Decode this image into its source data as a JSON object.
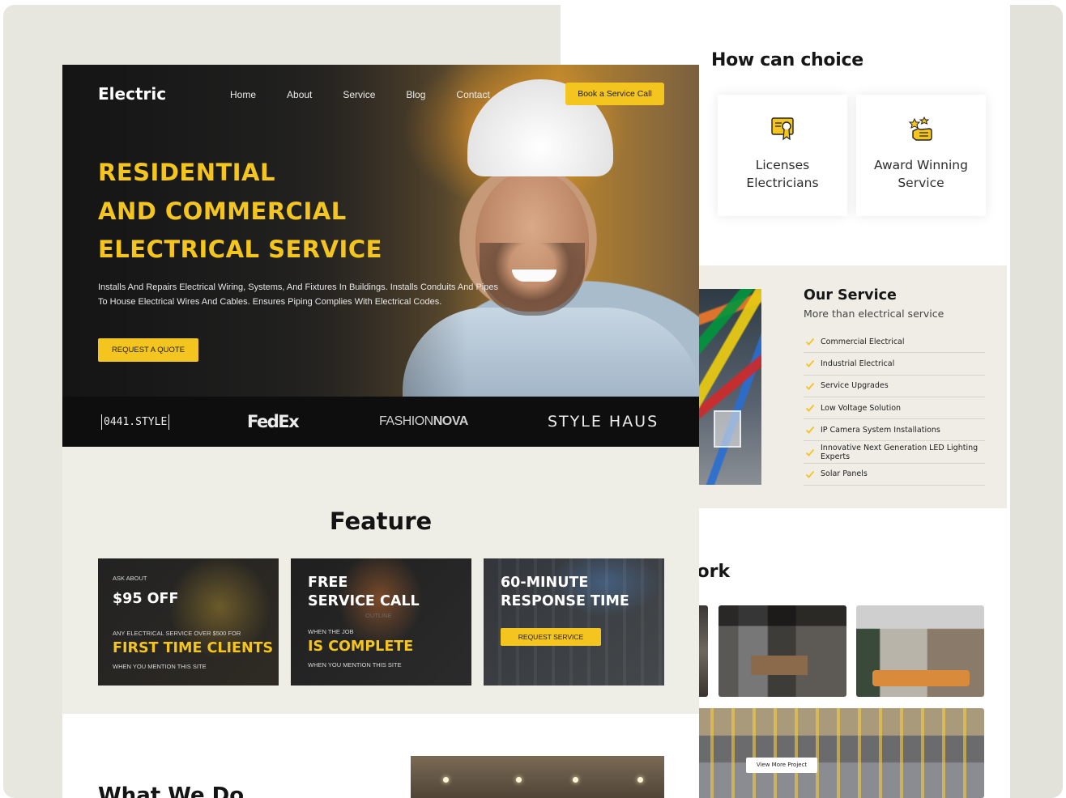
{
  "right": {
    "choice_title": "How can choice",
    "choice_cards": [
      {
        "label": "Licenses\nElectricians",
        "icon": "certificate-icon"
      },
      {
        "label": "Award Winning\nService",
        "icon": "award-hand-icon"
      }
    ],
    "service": {
      "title": "Our Service",
      "subtitle": "More than electrical service",
      "items": [
        "Commercial Electrical",
        "Industrial Electrical",
        "Service Upgrades",
        "Low Voltage Solution",
        "IP Camera System Installations",
        "Innovative Next Generation LED Lighting Experts",
        "Solar Panels"
      ]
    },
    "work_title": "Work",
    "view_more": "View More Project"
  },
  "main": {
    "logo": "Electric",
    "nav": [
      "Home",
      "About",
      "Service",
      "Blog",
      "Contact"
    ],
    "book_button": "Book a Service Call",
    "hero_title": [
      "RESIDENTIAL",
      "AND COMMERCIAL",
      "ELECTRICAL SERVICE"
    ],
    "hero_desc": "Installs And Repairs Electrical Wiring, Systems, And Fixtures In Buildings. Installs Conduits And Pipes To House Electrical Wires And Cables. Ensures Piping Complies With Electrical Codes.",
    "quote_button": "REQUEST A QUOTE",
    "brands": {
      "b1": "0441.STYLE",
      "b2": "FedEx",
      "b3_light": "FASHION",
      "b3_bold": "NOVA",
      "b4": "STYLE HAUS"
    },
    "feature_title": "Feature",
    "cards": [
      {
        "ask": "ASK ABOUT",
        "big": "$95 OFF",
        "small": "ANY ELECTRICAL SERVICE OVER $500 FOR",
        "yellow": "FIRST TIME CLIENTS",
        "foot": "WHEN YOU MENTION THIS SITE"
      },
      {
        "line1": "FREE",
        "line2": "SERVICE CALL",
        "outline": "OUTLINE",
        "small": "WHEN THE JOB",
        "yellow": "IS COMPLETE",
        "foot": "WHEN YOU MENTION THIS SITE"
      },
      {
        "line1": "60-MINUTE",
        "line2": "RESPONSE TIME",
        "button": "REQUEST SERVICE"
      }
    ],
    "what_we_do": "What We Do"
  },
  "colors": {
    "accent": "#f4c41f",
    "dark": "#0e0e0e",
    "beige": "#efeee6"
  }
}
